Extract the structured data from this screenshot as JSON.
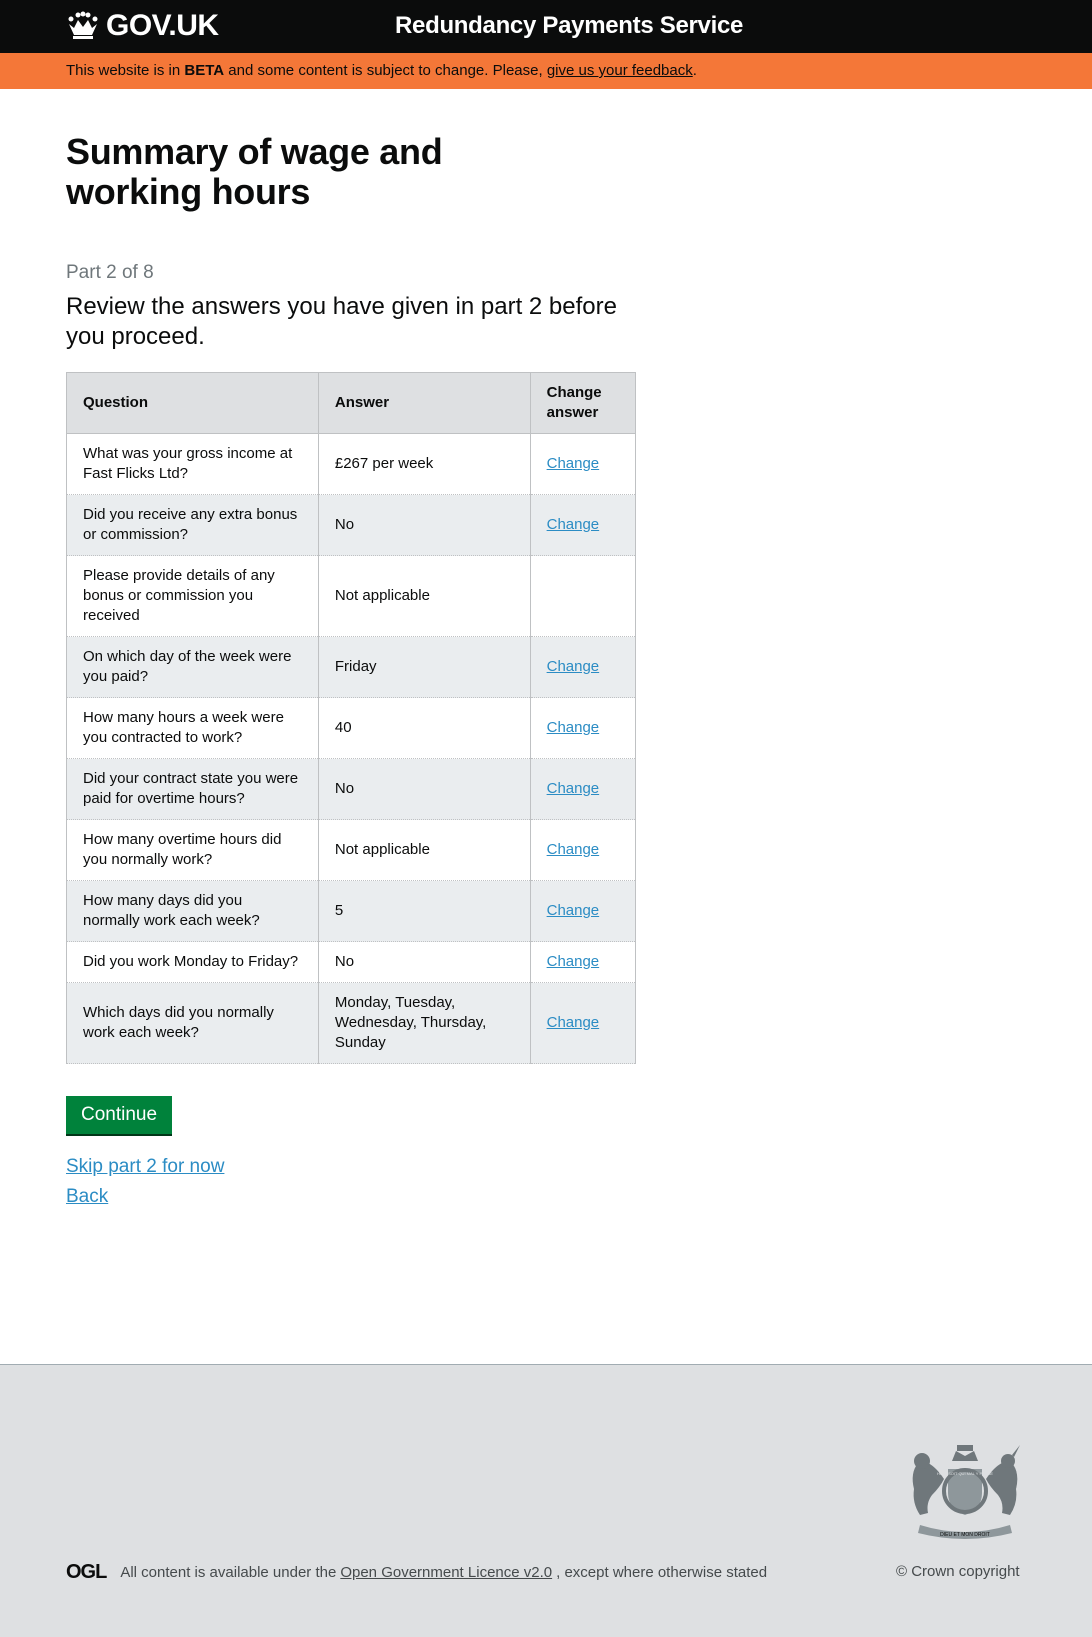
{
  "header": {
    "logo_text": "GOV.UK",
    "service_name": "Redundancy Payments Service"
  },
  "beta": {
    "prefix": "This website is in ",
    "tag": "BETA",
    "middle": " and some content is subject to change. Please, ",
    "link": "give us your feedback",
    "suffix": "."
  },
  "page": {
    "title": "Summary of wage and working hours",
    "caption": "Part 2 of 8",
    "lede": "Review the answers you have given in part 2 before you proceed."
  },
  "table": {
    "headers": {
      "question": "Question",
      "answer": "Answer",
      "change": "Change answer"
    },
    "rows": [
      {
        "q": "What was your gross income at Fast Flicks Ltd?",
        "a": "£267 per week",
        "c": "Change"
      },
      {
        "q": "Did you receive any extra bonus or commission?",
        "a": "No",
        "c": "Change"
      },
      {
        "q": "Please provide details of any bonus or commission you received",
        "a": "Not applicable",
        "c": ""
      },
      {
        "q": "On which day of the week were you paid?",
        "a": "Friday",
        "c": "Change"
      },
      {
        "q": "How many hours a week were you contracted to work?",
        "a": "40",
        "c": "Change"
      },
      {
        "q": "Did your contract state you were paid for overtime hours?",
        "a": "No",
        "c": "Change"
      },
      {
        "q": "How many overtime hours did you normally work?",
        "a": "Not applicable",
        "c": "Change"
      },
      {
        "q": "How many days did you normally work each week?",
        "a": "5",
        "c": "Change"
      },
      {
        "q": "Did you work Monday to Friday?",
        "a": "No",
        "c": "Change"
      },
      {
        "q": "Which days did you normally work each week?",
        "a": "Monday, Tuesday, Wednesday, Thursday, Sunday",
        "c": "Change"
      }
    ]
  },
  "actions": {
    "continue": "Continue",
    "skip": "Skip part 2 for now",
    "back": "Back"
  },
  "footer": {
    "ogl_logo": "OGL",
    "licence_prefix": "All content is available under the",
    "licence_link": "Open Government Licence v2.0",
    "licence_suffix": ", except where otherwise stated",
    "copyright": "© Crown copyright",
    "crest_motto": "DIEU ET MON DROIT",
    "crest_garter": "HONI SOIT QUI MAL Y PENSE"
  },
  "colors": {
    "header_bg": "#0b0c0c",
    "beta_bg": "#f47738",
    "link": "#2b8cc4",
    "button": "#00823b",
    "footer_bg": "#dee0e2"
  }
}
